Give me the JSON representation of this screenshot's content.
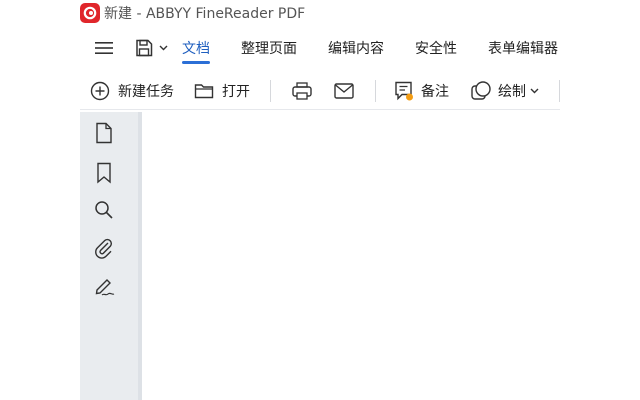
{
  "window": {
    "title": "新建 - ABBYY FineReader PDF",
    "accent_color": "#e0262b"
  },
  "menu": {
    "hamburger_icon": "hamburger-menu-icon",
    "save_icon": "floppy-disk-icon",
    "tabs": [
      {
        "label": "文档",
        "active": true
      },
      {
        "label": "整理页面",
        "active": false
      },
      {
        "label": "编辑内容",
        "active": false
      },
      {
        "label": "安全性",
        "active": false
      },
      {
        "label": "表单编辑器",
        "active": false
      }
    ],
    "active_color": "#1f5fbf"
  },
  "toolbar": {
    "new_task_label": "新建任务",
    "open_label": "打开",
    "print_icon": "printer-icon",
    "email_icon": "envelope-icon",
    "notes_label": "备注",
    "draw_label": "绘制"
  },
  "sidebar": {
    "items": [
      {
        "icon": "pages-icon"
      },
      {
        "icon": "bookmark-icon"
      },
      {
        "icon": "search-icon"
      },
      {
        "icon": "paperclip-icon"
      },
      {
        "icon": "signature-icon"
      }
    ]
  }
}
